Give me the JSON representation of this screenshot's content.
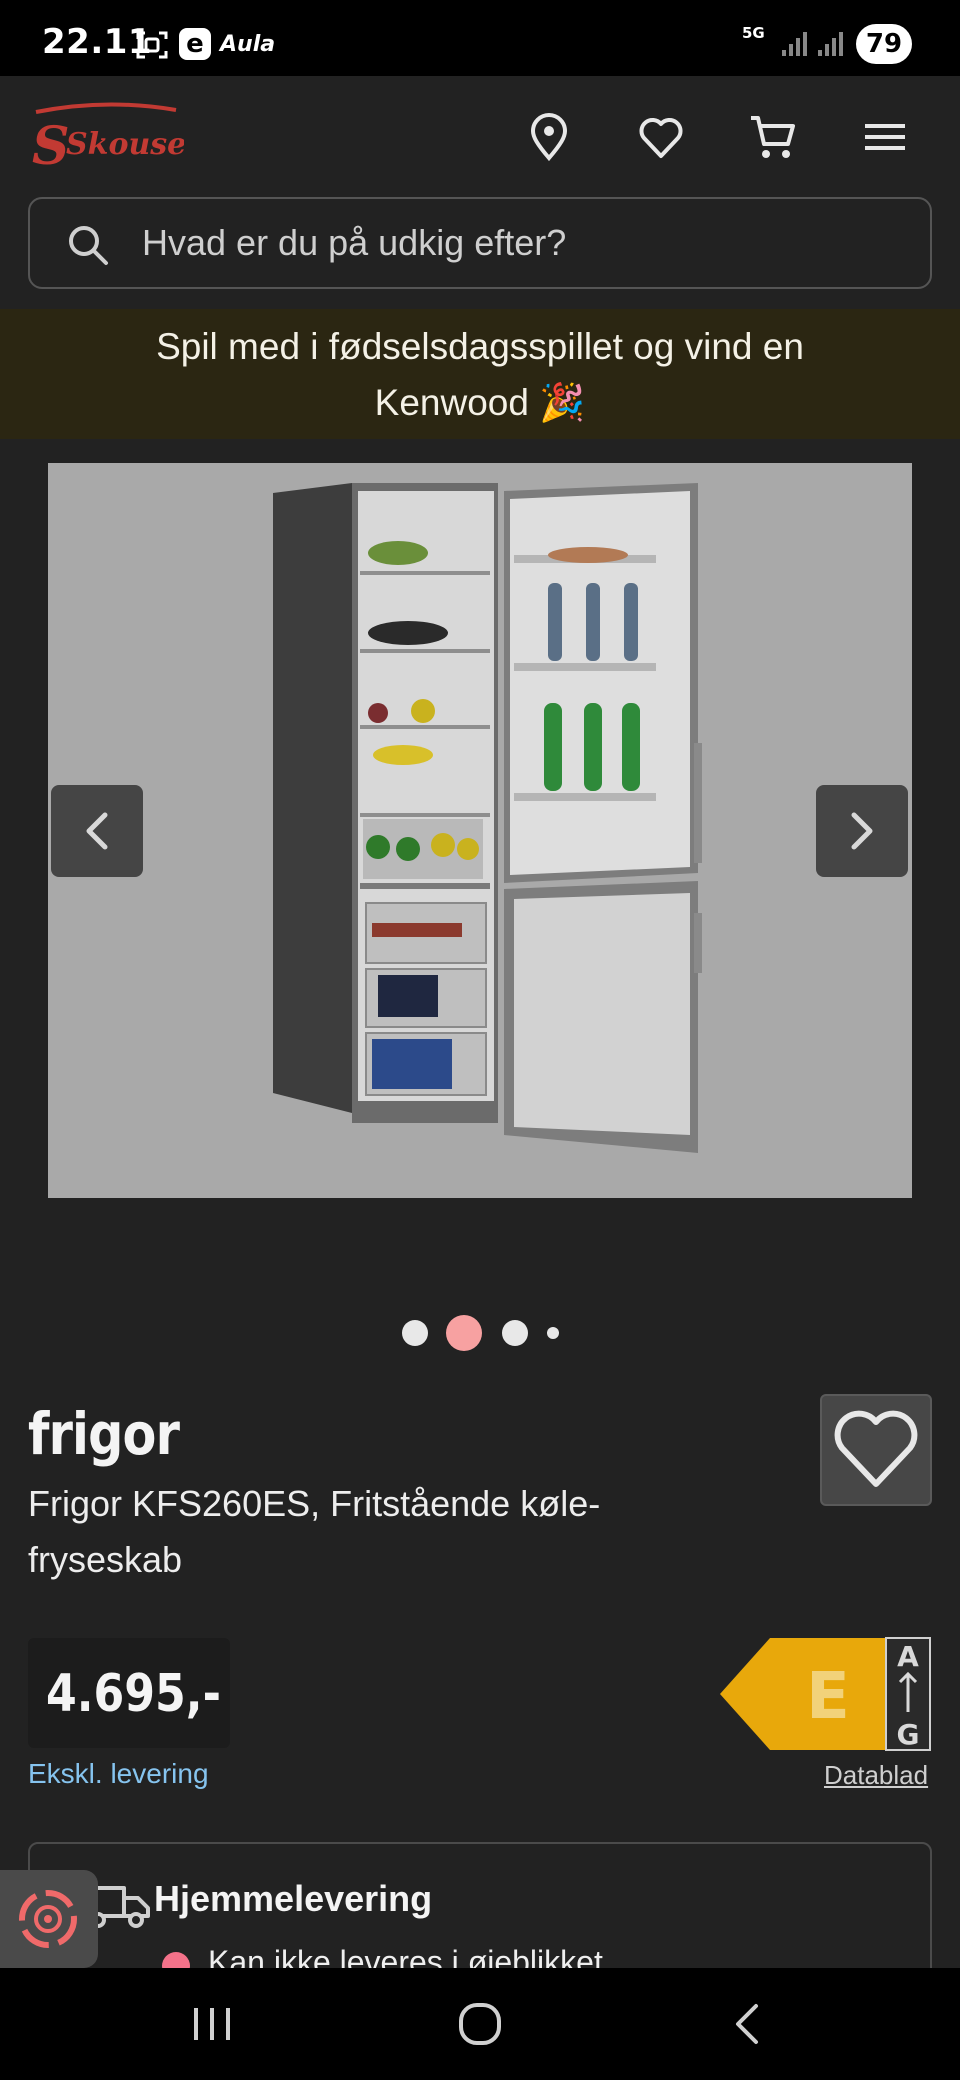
{
  "status_bar": {
    "time": "22.11",
    "app_icon_e": "e",
    "app_label": "Aula",
    "network": "5G",
    "battery": "79"
  },
  "header": {
    "logo_text": "Skousen",
    "icons": [
      "location-icon",
      "heart-icon",
      "cart-icon",
      "menu-icon"
    ]
  },
  "search": {
    "placeholder": "Hvad er du på udkig efter?"
  },
  "banner": {
    "text": "Spil med i fødselsdagsspillet og vind en Kenwood 🎉"
  },
  "gallery": {
    "image_count": 4,
    "active_index": 1
  },
  "product": {
    "brand": "frigor",
    "title": "Frigor KFS260ES, Fritstående køle-fryseskab",
    "price": "4.695,-",
    "price_note": "Ekskl. levering",
    "energy_class": "E",
    "energy_scale_top": "A",
    "energy_scale_bottom": "G",
    "datasheet_label": "Datablad"
  },
  "delivery": {
    "title": "Hjemmelevering",
    "status": "Kan ikke leveres i øjeblikket",
    "status_color": "#f4728a"
  },
  "colors": {
    "background": "#222222",
    "banner_bg": "#2b2612",
    "energy_yellow": "#e8a80b",
    "link_blue": "#86c4ef",
    "active_dot": "#f7a1a1"
  }
}
